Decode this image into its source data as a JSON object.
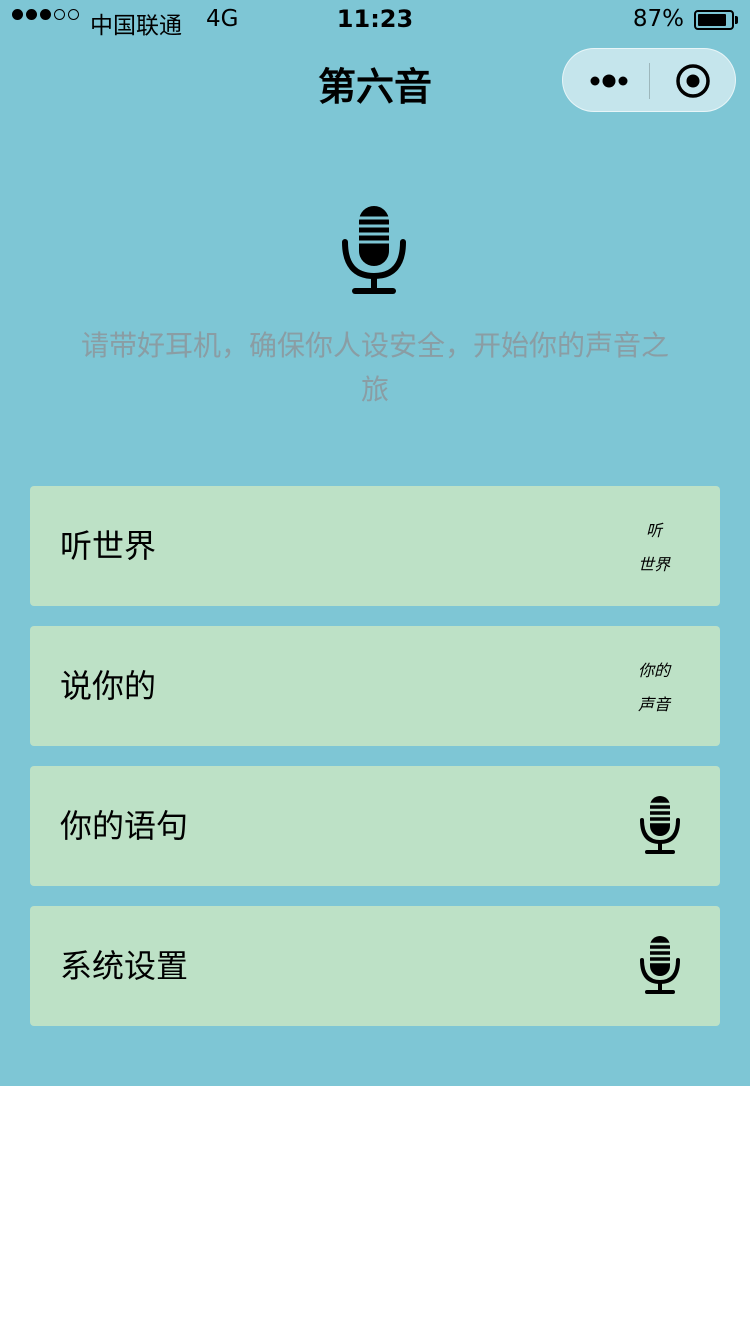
{
  "status_bar": {
    "signal_bars": 3,
    "signal_total": 5,
    "carrier": "中国联通",
    "network": "4G",
    "time": "11:23",
    "battery_percent": "87%",
    "battery_level": 0.87
  },
  "nav": {
    "title": "第六音",
    "capsule_icons": [
      "more-icon",
      "target-icon"
    ]
  },
  "hero": {
    "icon": "microphone-icon",
    "text": "请带好耳机，确保你人设安全，开始你的声音之旅"
  },
  "menu": [
    {
      "label": "听世界",
      "badge_line1": "听",
      "badge_line2": "世界"
    },
    {
      "label": "说你的",
      "badge_line1": "你的",
      "badge_line2": "声音"
    },
    {
      "label": "你的语句",
      "icon": "microphone-icon"
    },
    {
      "label": "系统设置",
      "icon": "microphone-icon"
    }
  ],
  "colors": {
    "background": "#7ec6d5",
    "card": "#bde1c6",
    "hint_text": "#8a9da4",
    "page_bottom": "#ffffff"
  }
}
